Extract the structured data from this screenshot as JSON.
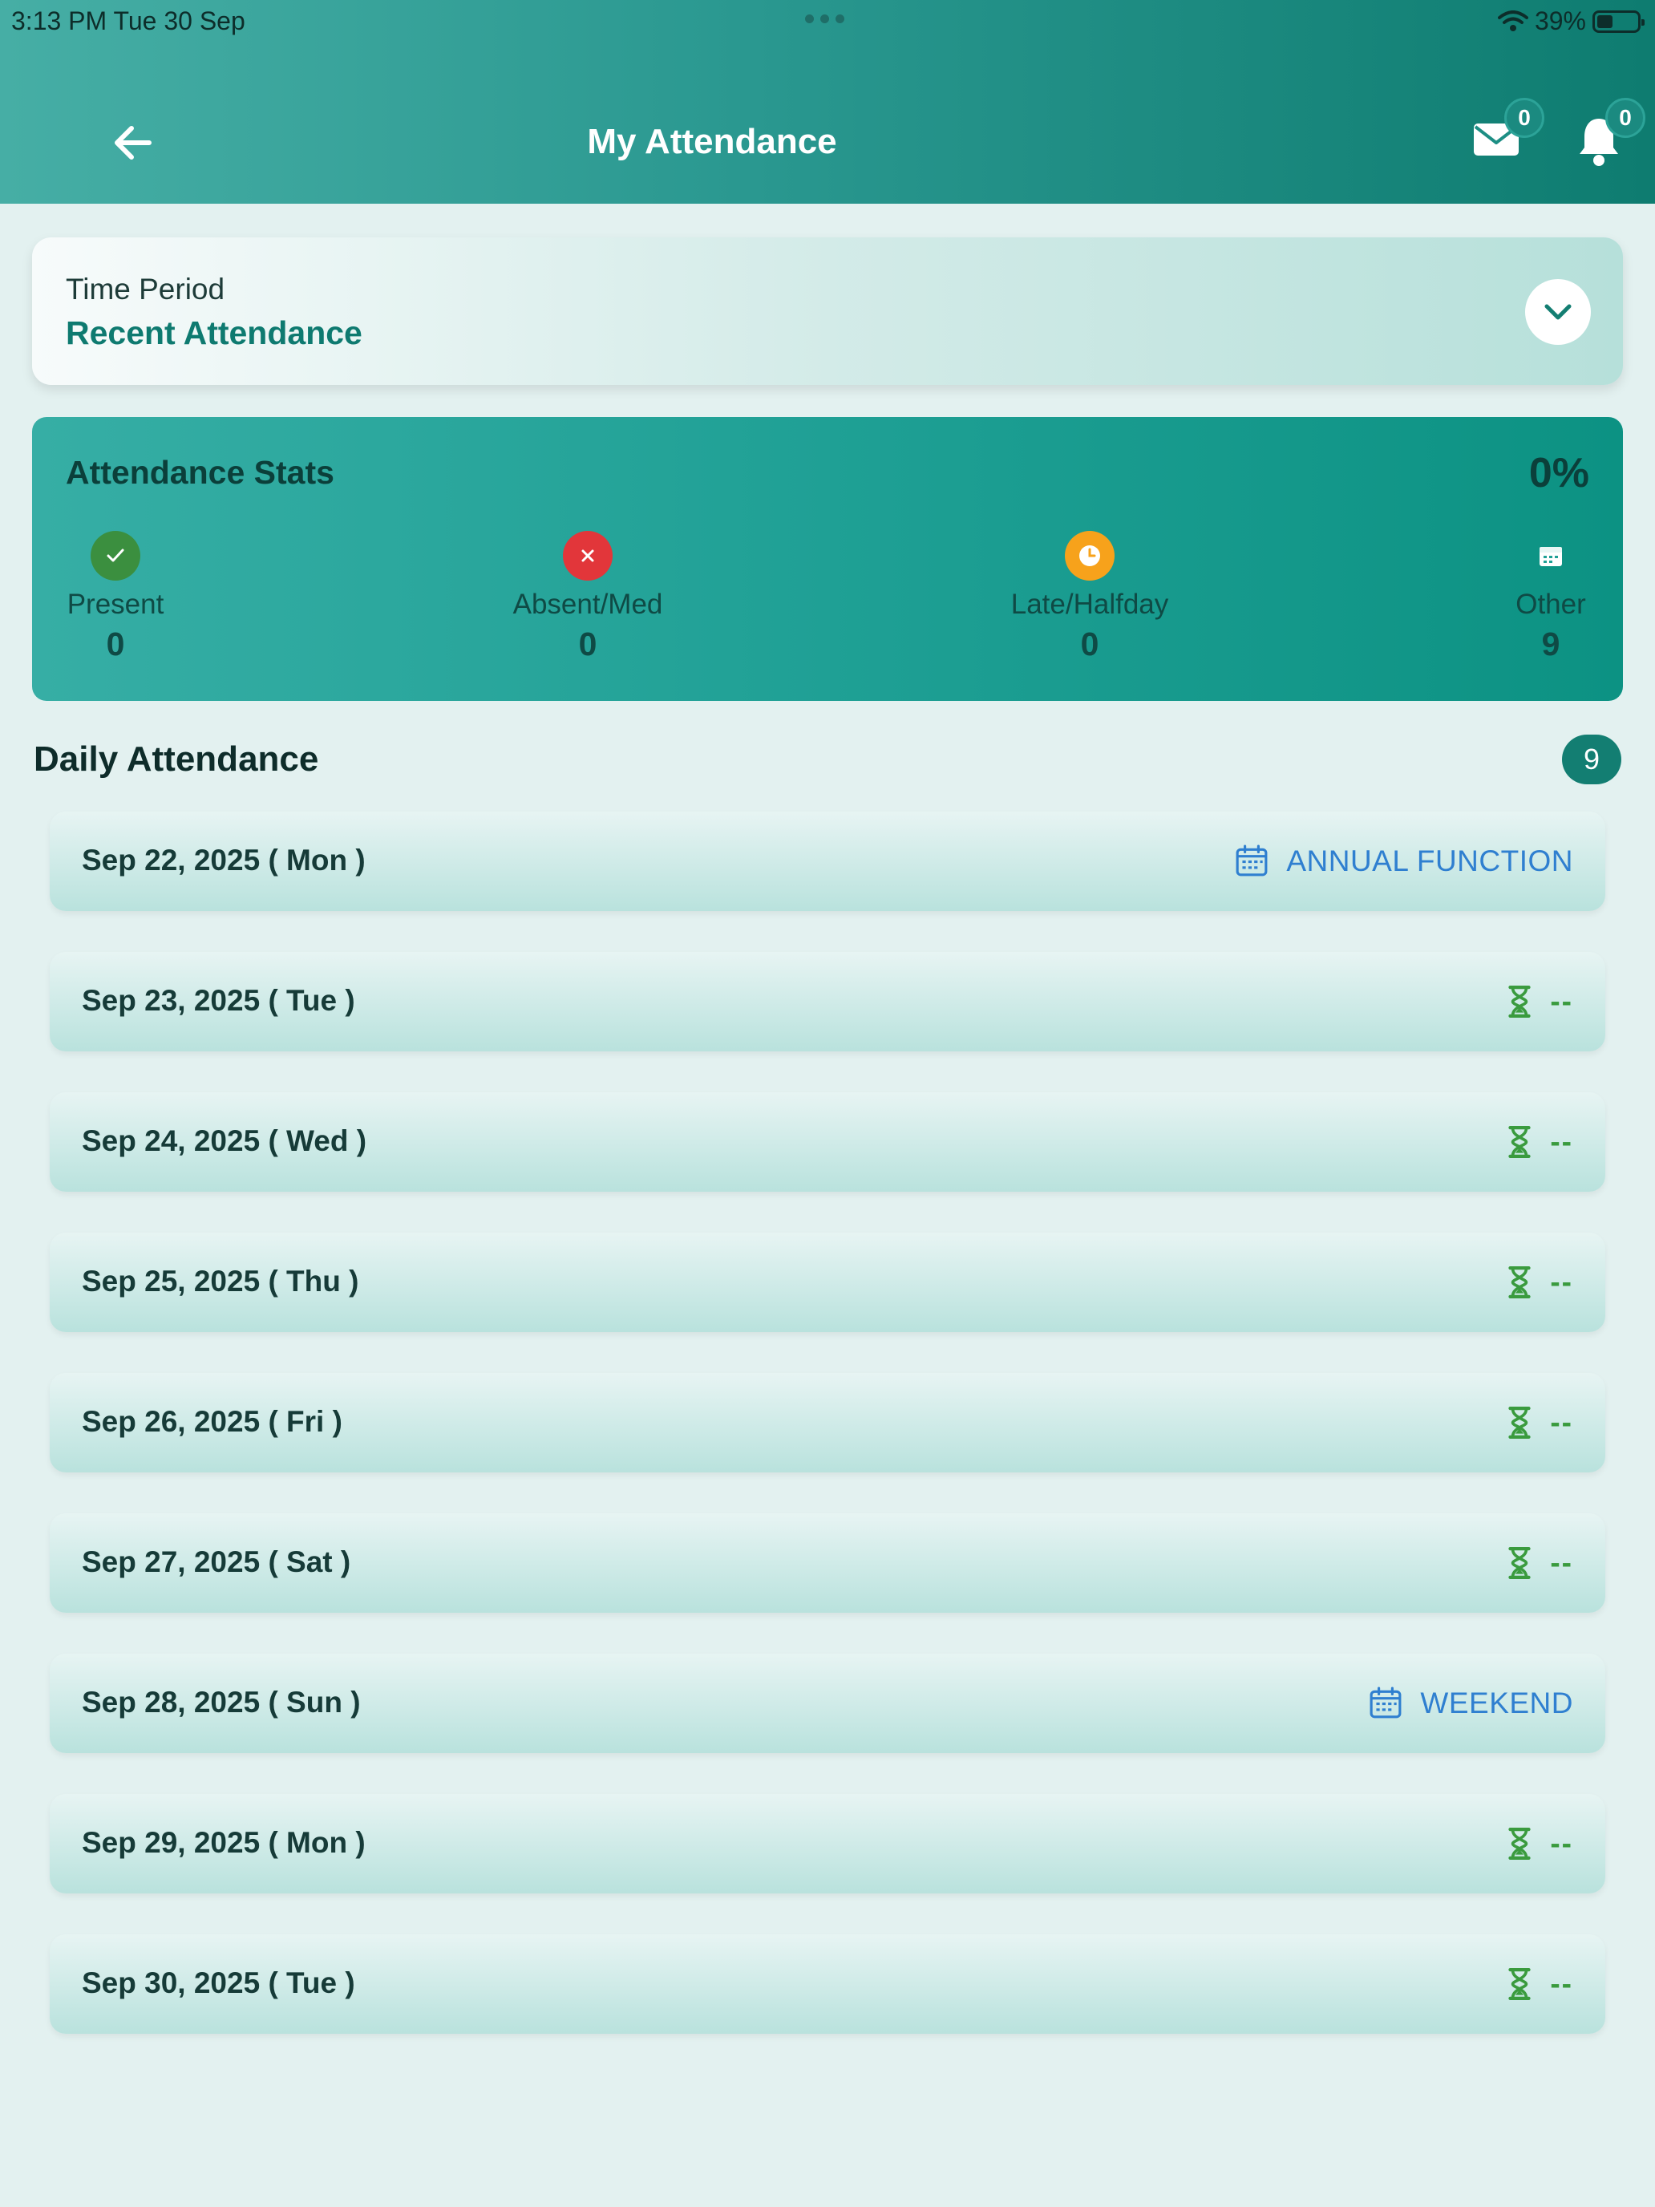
{
  "status_bar": {
    "time": "3:13 PM   Tue 30 Sep",
    "battery": "39%",
    "battery_level": 0.39
  },
  "header": {
    "title": "My Attendance",
    "mail_count": "0",
    "notification_count": "0"
  },
  "time_period": {
    "label": "Time Period",
    "value": "Recent Attendance"
  },
  "stats": {
    "title": "Attendance Stats",
    "percent": "0%",
    "present": {
      "label": "Present",
      "value": "0",
      "color": "#3b8f3f"
    },
    "absent": {
      "label": "Absent/Med",
      "value": "0",
      "color": "#e2363a"
    },
    "late": {
      "label": "Late/Halfday",
      "value": "0",
      "color": "#f7a21b"
    },
    "other": {
      "label": "Other",
      "value": "9"
    }
  },
  "daily": {
    "title": "Daily Attendance",
    "count": "9",
    "rows": [
      {
        "date": "Sep 22, 2025 ( Mon )",
        "status": "ANNUAL FUNCTION",
        "kind": "event"
      },
      {
        "date": "Sep 23, 2025 ( Tue )",
        "status": "--",
        "kind": "pending"
      },
      {
        "date": "Sep 24, 2025 ( Wed )",
        "status": "--",
        "kind": "pending"
      },
      {
        "date": "Sep 25, 2025 ( Thu )",
        "status": "--",
        "kind": "pending"
      },
      {
        "date": "Sep 26, 2025 ( Fri )",
        "status": "--",
        "kind": "pending"
      },
      {
        "date": "Sep 27, 2025 ( Sat )",
        "status": "--",
        "kind": "pending"
      },
      {
        "date": "Sep 28, 2025 ( Sun )",
        "status": "WEEKEND",
        "kind": "event"
      },
      {
        "date": "Sep 29, 2025 ( Mon )",
        "status": "--",
        "kind": "pending"
      },
      {
        "date": "Sep 30, 2025 ( Tue )",
        "status": "--",
        "kind": "pending"
      }
    ]
  },
  "colors": {
    "accent": "#137e72",
    "event": "#2f7fd0",
    "pending": "#3a9b3e"
  }
}
